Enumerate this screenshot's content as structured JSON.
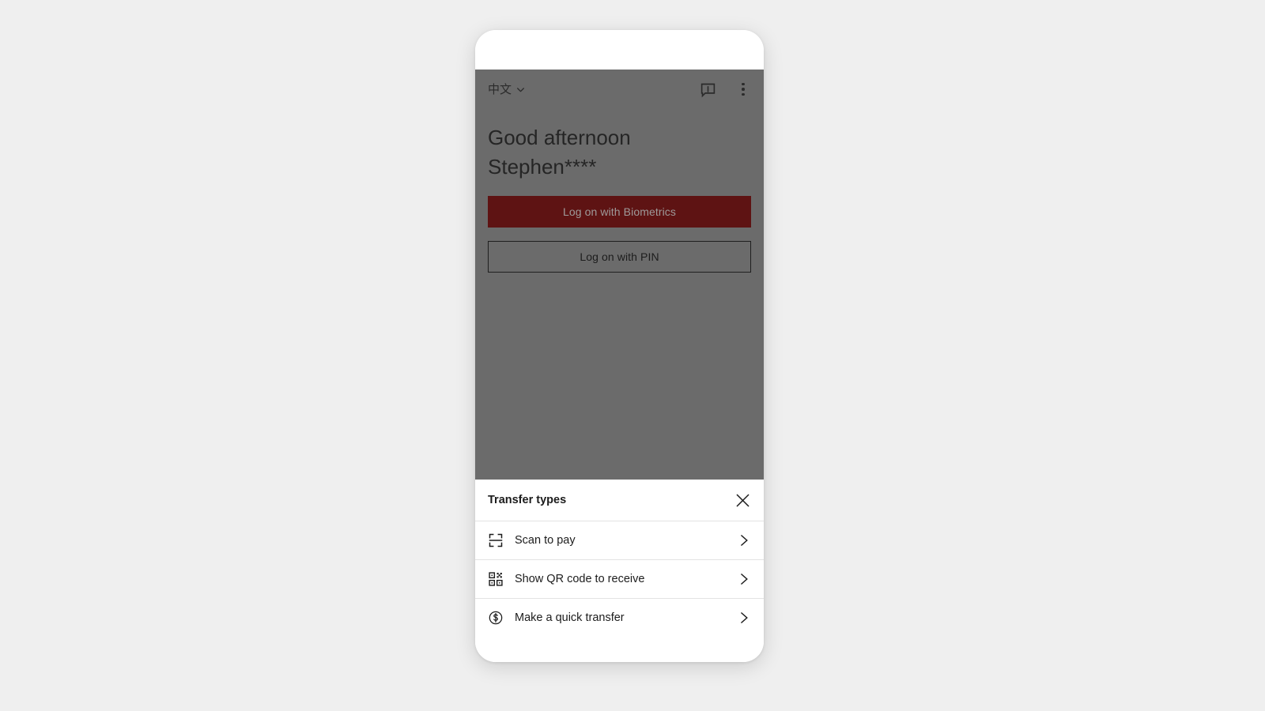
{
  "theme": {
    "page_background": "#efefef",
    "device_background": "#ffffff",
    "scrim": "#6b6b6b",
    "brand_red": "#5e1313",
    "text_primary": "#1c1c1c",
    "divider": "#e3e3e3"
  },
  "app_bar": {
    "language": {
      "label": "中文",
      "chevron_icon": "chevron-down-icon"
    },
    "actions": [
      {
        "icon": "message-alert-icon",
        "name": "messages-button"
      },
      {
        "icon": "overflow-menu-icon",
        "name": "overflow-menu-button"
      }
    ]
  },
  "greeting": {
    "line1": "Good afternoon",
    "line2": "Stephen****"
  },
  "logon": {
    "biometrics_label": "Log on with Biometrics",
    "pin_label": "Log on with PIN"
  },
  "bottom_sheet": {
    "title": "Transfer types",
    "close_icon": "close-icon",
    "rows": [
      {
        "label": "Scan to pay",
        "icon": "scan-frame-icon",
        "chevron": "chevron-right-icon"
      },
      {
        "label": "Show QR code to receive",
        "icon": "qr-code-icon",
        "chevron": "chevron-right-icon"
      },
      {
        "label": "Make a quick transfer",
        "icon": "dollar-circle-icon",
        "chevron": "chevron-right-icon"
      }
    ]
  }
}
